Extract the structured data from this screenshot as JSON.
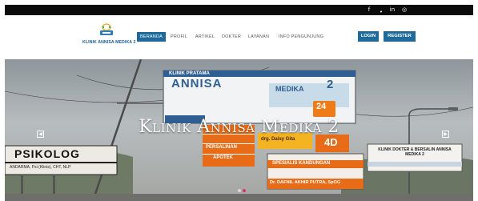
{
  "topbar": {
    "social_icons": [
      "facebook-icon",
      "twitter-icon",
      "linkedin-icon",
      "instagram-icon"
    ],
    "glyphs": [
      "f",
      "❟",
      "in",
      "◎"
    ]
  },
  "logo": {
    "text": "KLINIK ANNISA MEDIKA 2"
  },
  "nav": [
    "BERANDA",
    "PROFIL",
    "ARTIKEL",
    "DOKTER",
    "LAYANAN",
    "INFO PENGUNJUNG"
  ],
  "auth": {
    "login": "LOGIN",
    "register": "REGISTER"
  },
  "hero": {
    "title": "Klinik Annisa Medika 2",
    "prev_glyph": "◀",
    "next_glyph": "▶",
    "slides": 2,
    "active_slide": 2,
    "signs": {
      "main_top": "KLINIK PRATAMA",
      "main_name": "ANNISA",
      "main_name2": "MEDIKA",
      "main_num": "2",
      "main_24": "24",
      "psikolog": "PSIKOLOG",
      "psikolog_sub": "ANDARMA, Psi (Klinis), CHT, NLP",
      "orange_1": "PERSALINAN",
      "orange_2": "APOTEK",
      "drg": "drg. Daisy Gita",
      "num_4d": "4D",
      "spesialis": "SPESIALIS KANDUNGAN",
      "dokter": "Dr. DAFNIL AKHIR PUTRA, SpOG",
      "right_sign": "KLINIK DOKTER & BERSALIN ANNISA MEDIKA 2"
    }
  },
  "colors": {
    "brand": "#1e6b9b",
    "topbar": "#0b0b0b"
  }
}
